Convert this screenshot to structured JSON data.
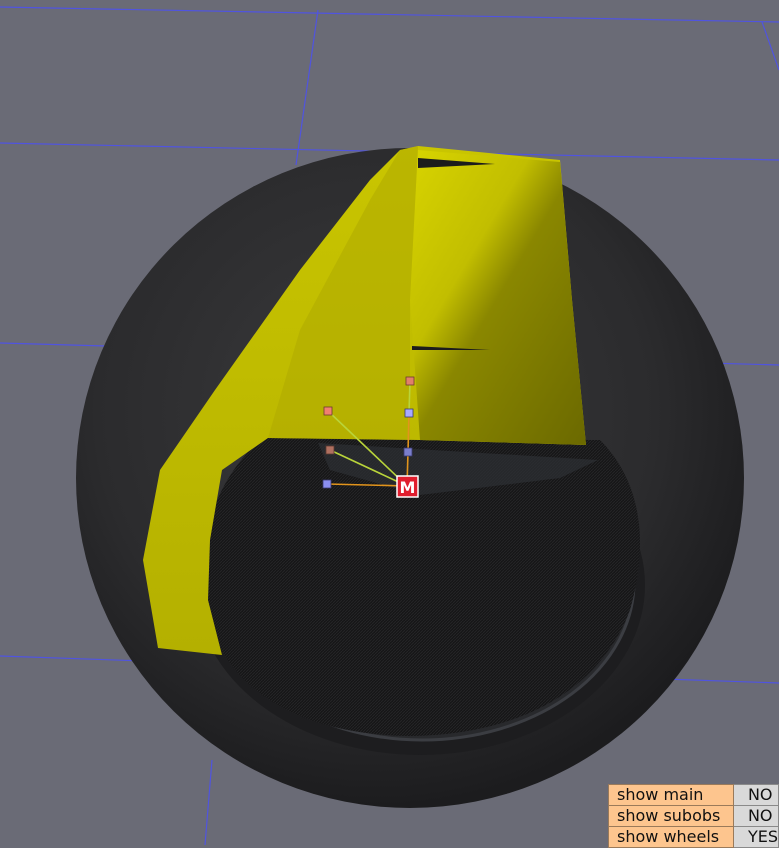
{
  "scene": {
    "marker_label": "M"
  },
  "properties": [
    {
      "label": "show main",
      "value": "NO"
    },
    {
      "label": "show subobs",
      "value": "NO"
    },
    {
      "label": "show wheels",
      "value": "YES"
    }
  ],
  "colors": {
    "background": "#6a6b76",
    "grid_line": "#5054e0",
    "tire": "#2a2a2c",
    "fender": "#c9c400",
    "marker": "#e01e2e",
    "label_bg": "#fdc58e",
    "value_bg": "#d9d9d9"
  }
}
